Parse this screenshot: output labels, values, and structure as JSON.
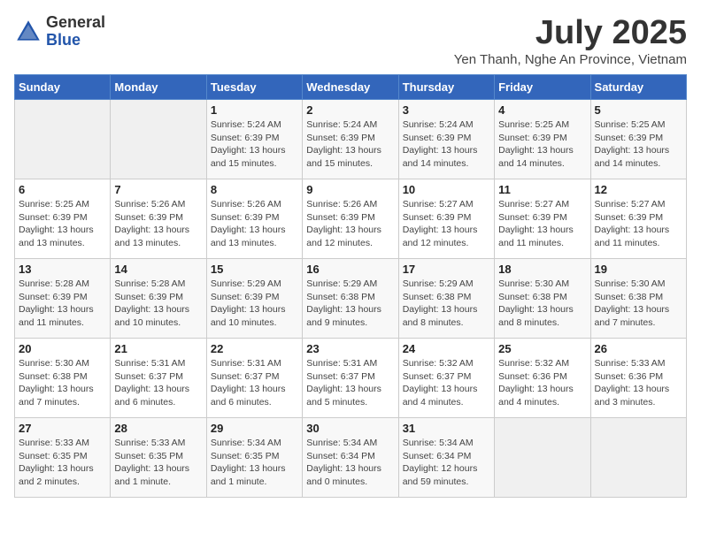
{
  "logo": {
    "general": "General",
    "blue": "Blue"
  },
  "title": "July 2025",
  "subtitle": "Yen Thanh, Nghe An Province, Vietnam",
  "days_of_week": [
    "Sunday",
    "Monday",
    "Tuesday",
    "Wednesday",
    "Thursday",
    "Friday",
    "Saturday"
  ],
  "weeks": [
    [
      {
        "day": "",
        "detail": ""
      },
      {
        "day": "",
        "detail": ""
      },
      {
        "day": "1",
        "detail": "Sunrise: 5:24 AM\nSunset: 6:39 PM\nDaylight: 13 hours and 15 minutes."
      },
      {
        "day": "2",
        "detail": "Sunrise: 5:24 AM\nSunset: 6:39 PM\nDaylight: 13 hours and 15 minutes."
      },
      {
        "day": "3",
        "detail": "Sunrise: 5:24 AM\nSunset: 6:39 PM\nDaylight: 13 hours and 14 minutes."
      },
      {
        "day": "4",
        "detail": "Sunrise: 5:25 AM\nSunset: 6:39 PM\nDaylight: 13 hours and 14 minutes."
      },
      {
        "day": "5",
        "detail": "Sunrise: 5:25 AM\nSunset: 6:39 PM\nDaylight: 13 hours and 14 minutes."
      }
    ],
    [
      {
        "day": "6",
        "detail": "Sunrise: 5:25 AM\nSunset: 6:39 PM\nDaylight: 13 hours and 13 minutes."
      },
      {
        "day": "7",
        "detail": "Sunrise: 5:26 AM\nSunset: 6:39 PM\nDaylight: 13 hours and 13 minutes."
      },
      {
        "day": "8",
        "detail": "Sunrise: 5:26 AM\nSunset: 6:39 PM\nDaylight: 13 hours and 13 minutes."
      },
      {
        "day": "9",
        "detail": "Sunrise: 5:26 AM\nSunset: 6:39 PM\nDaylight: 13 hours and 12 minutes."
      },
      {
        "day": "10",
        "detail": "Sunrise: 5:27 AM\nSunset: 6:39 PM\nDaylight: 13 hours and 12 minutes."
      },
      {
        "day": "11",
        "detail": "Sunrise: 5:27 AM\nSunset: 6:39 PM\nDaylight: 13 hours and 11 minutes."
      },
      {
        "day": "12",
        "detail": "Sunrise: 5:27 AM\nSunset: 6:39 PM\nDaylight: 13 hours and 11 minutes."
      }
    ],
    [
      {
        "day": "13",
        "detail": "Sunrise: 5:28 AM\nSunset: 6:39 PM\nDaylight: 13 hours and 11 minutes."
      },
      {
        "day": "14",
        "detail": "Sunrise: 5:28 AM\nSunset: 6:39 PM\nDaylight: 13 hours and 10 minutes."
      },
      {
        "day": "15",
        "detail": "Sunrise: 5:29 AM\nSunset: 6:39 PM\nDaylight: 13 hours and 10 minutes."
      },
      {
        "day": "16",
        "detail": "Sunrise: 5:29 AM\nSunset: 6:38 PM\nDaylight: 13 hours and 9 minutes."
      },
      {
        "day": "17",
        "detail": "Sunrise: 5:29 AM\nSunset: 6:38 PM\nDaylight: 13 hours and 8 minutes."
      },
      {
        "day": "18",
        "detail": "Sunrise: 5:30 AM\nSunset: 6:38 PM\nDaylight: 13 hours and 8 minutes."
      },
      {
        "day": "19",
        "detail": "Sunrise: 5:30 AM\nSunset: 6:38 PM\nDaylight: 13 hours and 7 minutes."
      }
    ],
    [
      {
        "day": "20",
        "detail": "Sunrise: 5:30 AM\nSunset: 6:38 PM\nDaylight: 13 hours and 7 minutes."
      },
      {
        "day": "21",
        "detail": "Sunrise: 5:31 AM\nSunset: 6:37 PM\nDaylight: 13 hours and 6 minutes."
      },
      {
        "day": "22",
        "detail": "Sunrise: 5:31 AM\nSunset: 6:37 PM\nDaylight: 13 hours and 6 minutes."
      },
      {
        "day": "23",
        "detail": "Sunrise: 5:31 AM\nSunset: 6:37 PM\nDaylight: 13 hours and 5 minutes."
      },
      {
        "day": "24",
        "detail": "Sunrise: 5:32 AM\nSunset: 6:37 PM\nDaylight: 13 hours and 4 minutes."
      },
      {
        "day": "25",
        "detail": "Sunrise: 5:32 AM\nSunset: 6:36 PM\nDaylight: 13 hours and 4 minutes."
      },
      {
        "day": "26",
        "detail": "Sunrise: 5:33 AM\nSunset: 6:36 PM\nDaylight: 13 hours and 3 minutes."
      }
    ],
    [
      {
        "day": "27",
        "detail": "Sunrise: 5:33 AM\nSunset: 6:35 PM\nDaylight: 13 hours and 2 minutes."
      },
      {
        "day": "28",
        "detail": "Sunrise: 5:33 AM\nSunset: 6:35 PM\nDaylight: 13 hours and 1 minute."
      },
      {
        "day": "29",
        "detail": "Sunrise: 5:34 AM\nSunset: 6:35 PM\nDaylight: 13 hours and 1 minute."
      },
      {
        "day": "30",
        "detail": "Sunrise: 5:34 AM\nSunset: 6:34 PM\nDaylight: 13 hours and 0 minutes."
      },
      {
        "day": "31",
        "detail": "Sunrise: 5:34 AM\nSunset: 6:34 PM\nDaylight: 12 hours and 59 minutes."
      },
      {
        "day": "",
        "detail": ""
      },
      {
        "day": "",
        "detail": ""
      }
    ]
  ]
}
